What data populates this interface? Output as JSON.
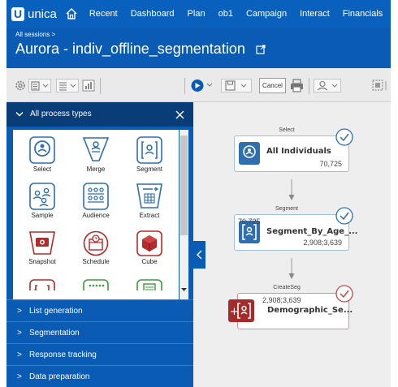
{
  "app": {
    "brand": "unica"
  },
  "nav": {
    "items": [
      "Recent",
      "Dashboard",
      "Plan",
      "ob1",
      "Campaign",
      "Interact",
      "Financials"
    ]
  },
  "header": {
    "breadcrumb": "All sessions >",
    "title": "Aurora - indiv_offline_segmentation"
  },
  "toolbar": {
    "cancel_label": "Cancel"
  },
  "palette": {
    "header": "All process types",
    "tiles": [
      {
        "label": "Select",
        "icon": "select-process-icon"
      },
      {
        "label": "Merge",
        "icon": "merge-process-icon"
      },
      {
        "label": "Segment",
        "icon": "segment-process-icon"
      },
      {
        "label": "Sample",
        "icon": "sample-process-icon"
      },
      {
        "label": "Audience",
        "icon": "audience-process-icon"
      },
      {
        "label": "Extract",
        "icon": "extract-process-icon"
      },
      {
        "label": "Snapshot",
        "icon": "snapshot-process-icon"
      },
      {
        "label": "Schedule",
        "icon": "schedule-process-icon"
      },
      {
        "label": "Cube",
        "icon": "cube-process-icon"
      }
    ],
    "categories": [
      "List generation",
      "Segmentation",
      "Response tracking",
      "Data preparation"
    ]
  },
  "flowchart": {
    "nodes": [
      {
        "type": "Select",
        "name": "All Individuals",
        "count_in": "",
        "count_out": "70,725"
      },
      {
        "type": "Segment",
        "name": "Segment_By_Age_...",
        "count_in": "70,725",
        "count_out": "2,908;3,639"
      },
      {
        "type": "CreateSeg",
        "name": "Demographic_Se...",
        "count_in": "2,908;3,639",
        "count_out": ""
      }
    ]
  },
  "colors": {
    "brand_blue": "#0a61bd",
    "palette_dark": "#083d78",
    "create_seg_red": "#a52a2a",
    "node_blue": "#2f6fb0"
  }
}
